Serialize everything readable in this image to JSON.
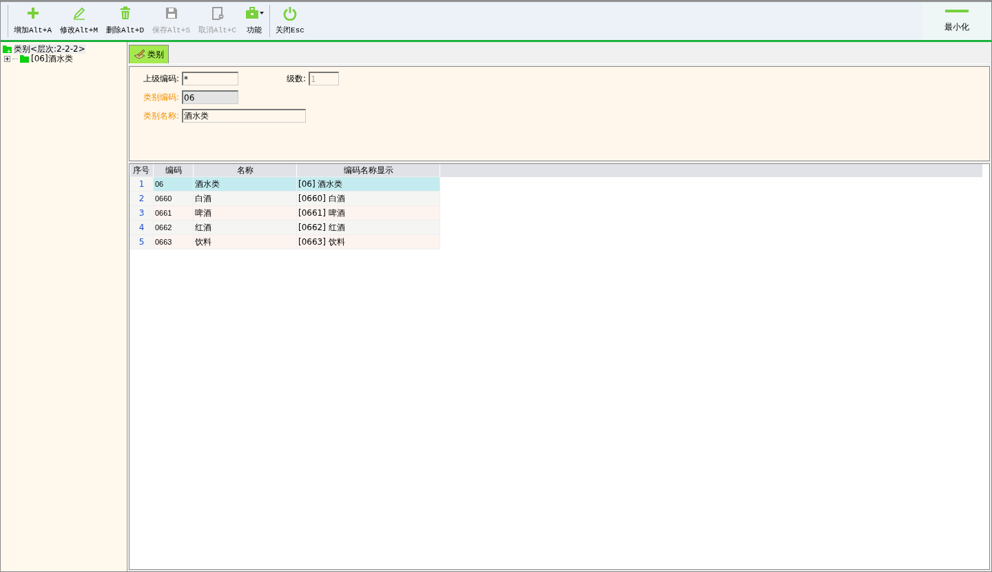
{
  "toolbar": {
    "buttons": [
      {
        "kind": "add",
        "label": "增加Alt+A",
        "disabled": false
      },
      {
        "kind": "edit",
        "label": "修改Alt+M",
        "disabled": false
      },
      {
        "kind": "delete",
        "label": "删除Alt+D",
        "disabled": false
      },
      {
        "kind": "save",
        "label": "保存Alt+S",
        "disabled": true
      },
      {
        "kind": "cancel",
        "label": "取消Alt+C",
        "disabled": true
      },
      {
        "kind": "tools",
        "label": "功能",
        "disabled": false
      },
      {
        "kind": "power",
        "label": "关闭Esc",
        "disabled": false
      }
    ],
    "minimize": {
      "label": "最小化"
    }
  },
  "tree": {
    "label": "类别<层次:2-2-2>",
    "selected": true,
    "children": [
      {
        "label": "[06]酒水类",
        "expanded": false,
        "selected": false
      }
    ]
  },
  "tabs": [
    {
      "label": "类别",
      "selected": true
    }
  ],
  "form": {
    "fields": [
      {
        "label": "上级编码:",
        "value": "*",
        "required": false,
        "kind": "normal"
      },
      {
        "label": "级数:",
        "value": "1",
        "required": false,
        "kind": "disabled"
      },
      {
        "label": "类别编码:",
        "value": "06",
        "required": true,
        "kind": "readonly"
      },
      {
        "label": "类别名称:",
        "value": "酒水类",
        "required": true,
        "kind": "normal"
      }
    ]
  },
  "table": {
    "columns": [
      "序号",
      "编码",
      "名称",
      "编码名称显示"
    ],
    "rows": [
      {
        "cells": [
          "1",
          "06",
          "酒水类",
          "[06] 酒水类"
        ],
        "selected": true
      },
      {
        "cells": [
          "2",
          "0660",
          "白酒",
          "[0660] 白酒"
        ],
        "selected": false
      },
      {
        "cells": [
          "3",
          "0661",
          "啤酒",
          "[0661] 啤酒"
        ],
        "selected": false
      },
      {
        "cells": [
          "4",
          "0662",
          "红酒",
          "[0662] 红酒"
        ],
        "selected": false
      },
      {
        "cells": [
          "5",
          "0663",
          "饮料",
          "[0663] 饮料"
        ],
        "selected": false
      }
    ]
  }
}
